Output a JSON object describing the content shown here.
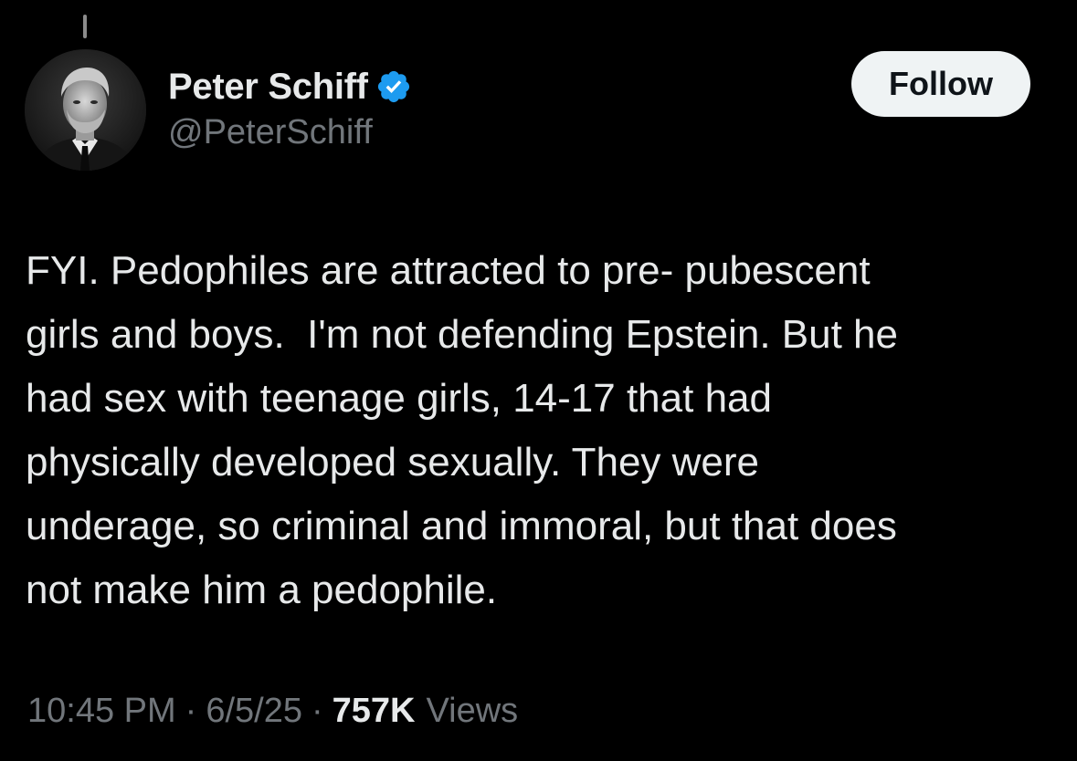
{
  "author": {
    "display_name": "Peter Schiff",
    "handle": "@PeterSchiff",
    "verified": true,
    "verified_color": "#1d9bf0"
  },
  "actions": {
    "follow_label": "Follow"
  },
  "tweet": {
    "text": "FYI. Pedophiles are attracted to pre- pubescent\ngirls and boys.  I'm not defending Epstein. But he\nhad sex with teenage girls, 14-17 that had\nphysically developed sexually. They were\nunderage, so criminal and immoral, but that does\nnot make him a pedophile."
  },
  "meta": {
    "time": "10:45 PM",
    "separator": "·",
    "date": "6/5/25",
    "views_count": "757K",
    "views_label": "Views"
  },
  "colors": {
    "background": "#000000",
    "primary_text": "#e7e9ea",
    "secondary_text": "#71767b",
    "follow_button_bg": "#eff3f4"
  },
  "icons": {
    "verified": "verified-badge-icon",
    "avatar": "profile-photo"
  }
}
